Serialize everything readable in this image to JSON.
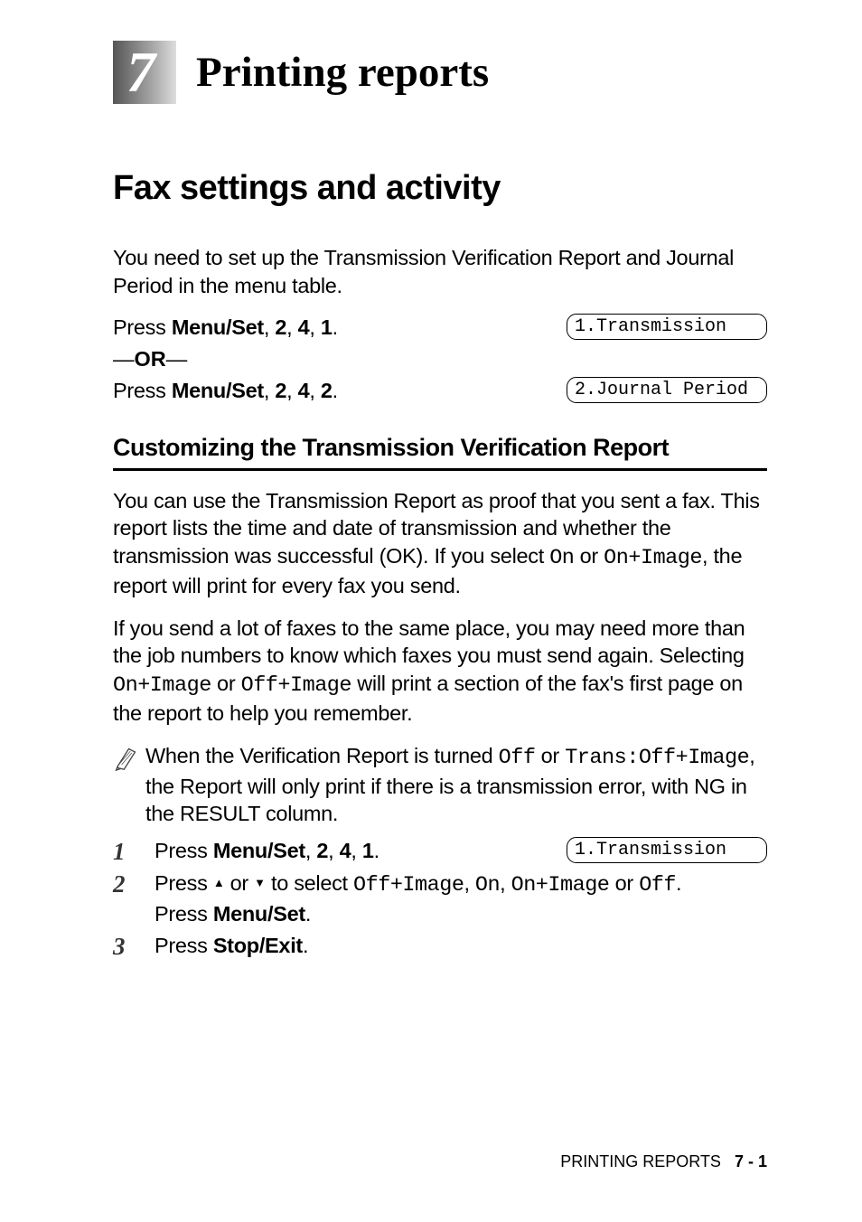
{
  "chapter": {
    "number": "7",
    "title": "Printing reports"
  },
  "section": {
    "title": "Fax settings and activity"
  },
  "intro": "You need to set up the Transmission Verification Report and Journal Period in the menu table.",
  "press1_pre": "Press ",
  "menuset": "Menu/Set",
  "press1_post": ", ",
  "k2": "2",
  "k4": "4",
  "k1": "1",
  "k2b": "2",
  "period": ".",
  "comma": ", ",
  "or": "OR",
  "lcd": {
    "trans1": "1.Transmission",
    "journal": "2.Journal Period",
    "trans2": "1.Transmission"
  },
  "sub": {
    "title": "Customizing the Transmission Verification Report"
  },
  "para1_a": "You can use the Transmission Report as proof that you sent a fax. This report lists the time and date of transmission and whether the transmission was successful (OK). If you select ",
  "para1_on": "On",
  "para1_b": " or ",
  "para1_onimg": "On+Image",
  "para1_c": ", the report will print for every fax you send.",
  "para2_a": "If you send a lot of faxes to the same place, you may need more than the job numbers to know which faxes you must send again. Selecting ",
  "para2_onimg": "On+Image",
  "para2_b": " or ",
  "para2_offimg": "Off+Image",
  "para2_c": " will print a section of the fax's first page on the report to help you remember.",
  "note_a": "When the Verification Report is turned ",
  "note_off": "Off",
  "note_b": " or ",
  "note_trans": "Trans:Off+Image",
  "note_c": ", the Report will only print if there is a transmission error, with NG in the RESULT column.",
  "steps": {
    "n1": "1",
    "n2": "2",
    "n3": "3",
    "s1_pre": "Press ",
    "s1_post": ", ",
    "s2_a": "Press ",
    "s2_b": " or ",
    "s2_c": " to select ",
    "s2_offimg": "Off+Image",
    "s2_d": ", ",
    "s2_on": "On",
    "s2_e": ", ",
    "s2_onimg": "On+Image",
    "s2_f": " or ",
    "s2_off": "Off",
    "s2_g": ".",
    "s2_press": "Press ",
    "s3_a": "Press ",
    "stopexit": "Stop/Exit"
  },
  "footer": {
    "label": "PRINTING REPORTS",
    "page": "7 - 1"
  }
}
